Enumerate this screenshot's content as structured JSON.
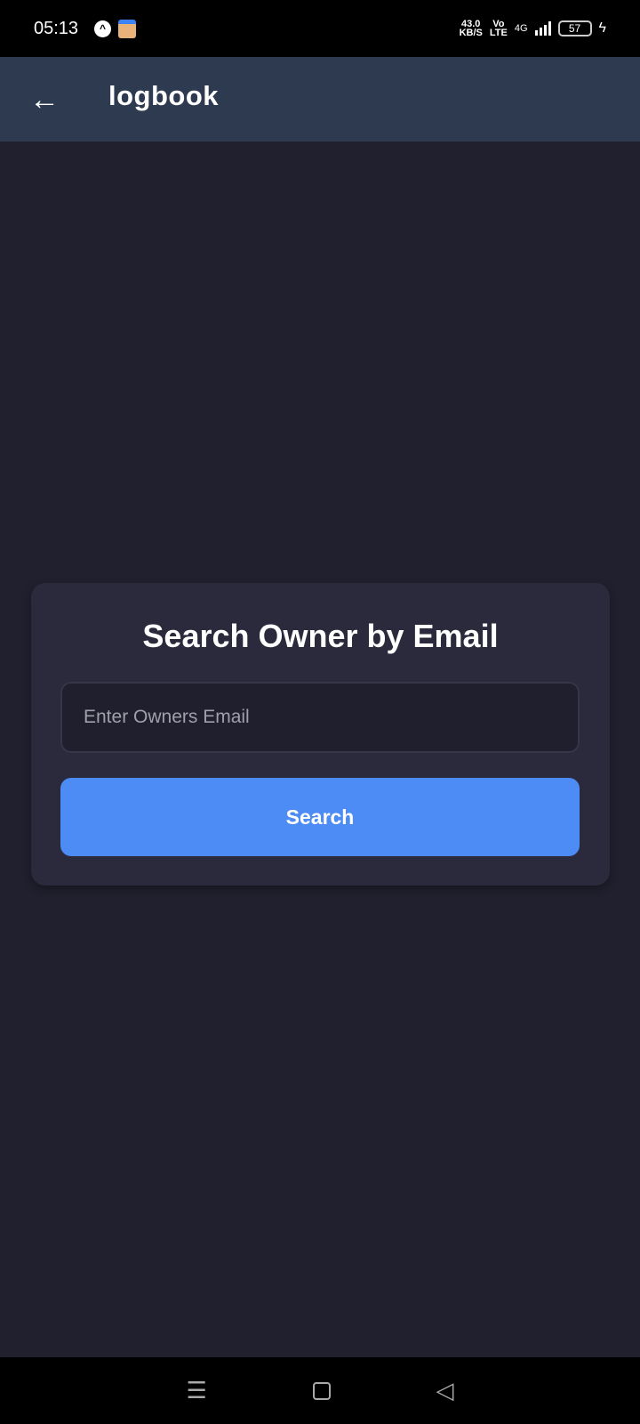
{
  "status_bar": {
    "time": "05:13",
    "speed_value": "43.0",
    "speed_unit": "KB/S",
    "volte": "Vo",
    "lte": "LTE",
    "network": "4G",
    "battery": "57"
  },
  "header": {
    "title": "logbook"
  },
  "card": {
    "title": "Search Owner by Email",
    "email_placeholder": "Enter Owners Email",
    "email_value": "",
    "search_label": "Search"
  },
  "colors": {
    "accent": "#4d8cf5",
    "header_bg": "#2e3a4f",
    "page_bg": "#20202e",
    "card_bg": "#2a2a3c"
  }
}
